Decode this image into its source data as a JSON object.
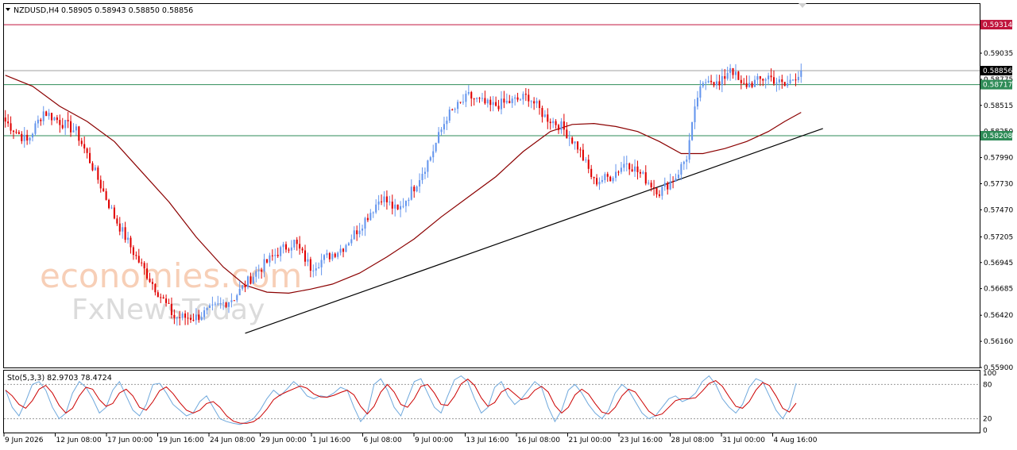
{
  "header": {
    "symbol": "NZDUSD,H4",
    "ohlc": "0.58905 0.58943 0.58850 0.58856"
  },
  "indicator_label": "Sto(5,3,3) 82.9703 78.4724",
  "watermark": {
    "line1": "economies.com",
    "line2": "FxNewsToday"
  },
  "colors": {
    "bull": "#6495ed",
    "bear": "#e00000",
    "ma": "#8b0000",
    "trendline": "#000000",
    "resistance": "#c0143c",
    "support": "#2e8b57",
    "current": "#a0a0a0",
    "stoch_main": "#6fa8dc",
    "stoch_signal": "#cc0000"
  },
  "chart_data": {
    "type": "candlestick",
    "title": "NZDUSD,H4",
    "ylim": [
      0.559,
      0.5952
    ],
    "y_ticks": [
      0.5903,
      0.5877,
      0.5851,
      0.5825,
      0.5799,
      0.5773,
      0.5747,
      0.572,
      0.56945,
      0.56685,
      0.5642,
      0.5616,
      0.559
    ],
    "y_tick_labels": [
      "0.59035",
      "0.58775",
      "0.58515",
      "0.58250",
      "0.57990",
      "0.57730",
      "0.57470",
      "0.57205",
      "0.56945",
      "0.56685",
      "0.56420",
      "0.56160",
      "0.55900"
    ],
    "x_tick_labels": [
      "9 Jun 2026",
      "12 Jun 08:00",
      "17 Jun 00:00",
      "19 Jun 16:00",
      "24 Jun 08:00",
      "29 Jun 00:00",
      "1 Jul 16:00",
      "6 Jul 08:00",
      "9 Jul 00:00",
      "13 Jul 16:00",
      "16 Jul 08:00",
      "21 Jul 00:00",
      "23 Jul 16:00",
      "28 Jul 08:00",
      "31 Jul 00:00",
      "4 Aug 16:00"
    ],
    "price_levels": [
      {
        "name": "resistance",
        "value": 0.59314,
        "label": "0.59314"
      },
      {
        "name": "current",
        "value": 0.58856,
        "label": "0.58856"
      },
      {
        "name": "support-1",
        "value": 0.58717,
        "label": "0.58717"
      },
      {
        "name": "support-2",
        "value": 0.58208,
        "label": "0.58208"
      }
    ],
    "anchors": [
      [
        0,
        0.5835
      ],
      [
        8,
        0.5815
      ],
      [
        14,
        0.5845
      ],
      [
        20,
        0.5835
      ],
      [
        26,
        0.5825
      ],
      [
        32,
        0.579
      ],
      [
        40,
        0.574
      ],
      [
        48,
        0.57
      ],
      [
        56,
        0.5665
      ],
      [
        62,
        0.564
      ],
      [
        70,
        0.564
      ],
      [
        76,
        0.5648
      ],
      [
        84,
        0.566
      ],
      [
        92,
        0.5685
      ],
      [
        100,
        0.5705
      ],
      [
        106,
        0.5715
      ],
      [
        112,
        0.569
      ],
      [
        118,
        0.57
      ],
      [
        124,
        0.571
      ],
      [
        130,
        0.573
      ],
      [
        138,
        0.576
      ],
      [
        144,
        0.5745
      ],
      [
        150,
        0.577
      ],
      [
        156,
        0.58
      ],
      [
        162,
        0.584
      ],
      [
        170,
        0.586
      ],
      [
        178,
        0.585
      ],
      [
        186,
        0.5855
      ],
      [
        192,
        0.586
      ],
      [
        198,
        0.584
      ],
      [
        204,
        0.583
      ],
      [
        210,
        0.581
      ],
      [
        216,
        0.5775
      ],
      [
        222,
        0.578
      ],
      [
        228,
        0.5795
      ],
      [
        234,
        0.578
      ],
      [
        240,
        0.5765
      ],
      [
        246,
        0.578
      ],
      [
        250,
        0.58
      ],
      [
        254,
        0.586
      ],
      [
        258,
        0.588
      ],
      [
        262,
        0.587
      ],
      [
        266,
        0.589
      ],
      [
        270,
        0.587
      ],
      [
        276,
        0.5875
      ],
      [
        280,
        0.588
      ],
      [
        286,
        0.587
      ],
      [
        292,
        0.5886
      ]
    ],
    "candle_count": 293,
    "ma_points": [
      [
        0,
        0.5881
      ],
      [
        10,
        0.587
      ],
      [
        20,
        0.585
      ],
      [
        30,
        0.5835
      ],
      [
        40,
        0.5815
      ],
      [
        50,
        0.5785
      ],
      [
        60,
        0.5755
      ],
      [
        70,
        0.572
      ],
      [
        80,
        0.569
      ],
      [
        88,
        0.5672
      ],
      [
        96,
        0.5665
      ],
      [
        104,
        0.5664
      ],
      [
        112,
        0.5668
      ],
      [
        120,
        0.5673
      ],
      [
        130,
        0.5684
      ],
      [
        140,
        0.57
      ],
      [
        150,
        0.5718
      ],
      [
        160,
        0.574
      ],
      [
        170,
        0.576
      ],
      [
        180,
        0.578
      ],
      [
        190,
        0.5805
      ],
      [
        200,
        0.5825
      ],
      [
        208,
        0.5832
      ],
      [
        216,
        0.5833
      ],
      [
        224,
        0.583
      ],
      [
        232,
        0.5825
      ],
      [
        240,
        0.5815
      ],
      [
        248,
        0.5803
      ],
      [
        256,
        0.5803
      ],
      [
        264,
        0.5808
      ],
      [
        272,
        0.5815
      ],
      [
        280,
        0.5825
      ],
      [
        286,
        0.5835
      ],
      [
        292,
        0.5844
      ]
    ],
    "trendline": {
      "x1": 88,
      "y1": 0.5624,
      "x2": 300,
      "y2": 0.5828
    },
    "stochastic": {
      "k": 82.9703,
      "d": 78.4724,
      "levels": [
        20,
        80
      ],
      "scale_labels": [
        "100",
        "80",
        "20",
        "0"
      ],
      "points": [
        70,
        40,
        25,
        50,
        80,
        85,
        70,
        40,
        20,
        30,
        65,
        85,
        75,
        55,
        30,
        40,
        70,
        85,
        60,
        35,
        25,
        45,
        80,
        82,
        65,
        45,
        35,
        25,
        30,
        50,
        60,
        40,
        20,
        15,
        12,
        10,
        14,
        20,
        35,
        55,
        70,
        60,
        72,
        85,
        75,
        60,
        55,
        60,
        58,
        65,
        75,
        70,
        40,
        15,
        30,
        80,
        90,
        70,
        40,
        25,
        55,
        85,
        90,
        65,
        40,
        30,
        60,
        88,
        95,
        85,
        55,
        30,
        40,
        75,
        85,
        60,
        45,
        55,
        70,
        85,
        75,
        40,
        15,
        35,
        70,
        80,
        65,
        45,
        30,
        20,
        35,
        65,
        80,
        70,
        50,
        30,
        20,
        25,
        40,
        55,
        60,
        50,
        55,
        65,
        85,
        95,
        80,
        55,
        40,
        30,
        45,
        75,
        90,
        85,
        60,
        35,
        20,
        40,
        82
      ]
    }
  }
}
